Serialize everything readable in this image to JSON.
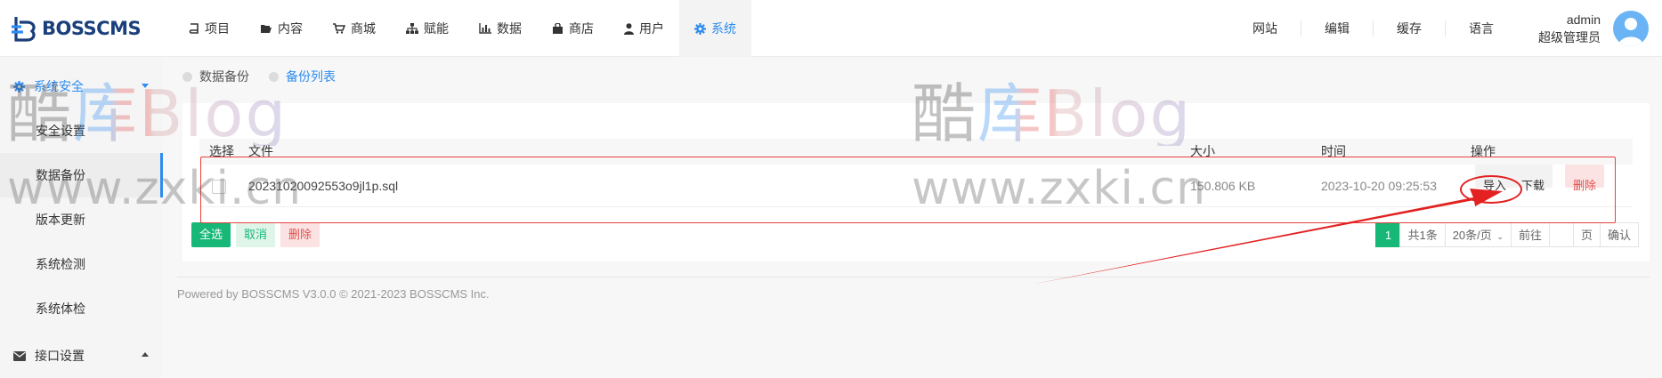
{
  "brand": {
    "name": "BOSSCMS",
    "color": "#1a3f7a",
    "accent": "#2d8cf0"
  },
  "nav": [
    {
      "label": "项目",
      "icon": "book-icon"
    },
    {
      "label": "内容",
      "icon": "folder-open-icon"
    },
    {
      "label": "商城",
      "icon": "shopping-cart-icon"
    },
    {
      "label": "赋能",
      "icon": "sitemap-icon"
    },
    {
      "label": "数据",
      "icon": "bar-chart-icon"
    },
    {
      "label": "商店",
      "icon": "store-bag-icon"
    },
    {
      "label": "用户",
      "icon": "user-icon"
    },
    {
      "label": "系统",
      "icon": "gear-icon",
      "active": true
    }
  ],
  "top_links": [
    "网站",
    "编辑",
    "缓存",
    "语言"
  ],
  "user": {
    "name": "admin",
    "role": "超级管理员"
  },
  "sidebar": {
    "group_security": {
      "label": "系统安全",
      "icon": "gear-icon",
      "expanded": true
    },
    "items": [
      {
        "label": "安全设置"
      },
      {
        "label": "数据备份",
        "active": true
      },
      {
        "label": "版本更新"
      },
      {
        "label": "系统检测"
      },
      {
        "label": "系统体检"
      }
    ],
    "group_api": {
      "label": "接口设置",
      "icon": "envelope-icon"
    }
  },
  "subtabs": [
    {
      "label": "数据备份",
      "active": false
    },
    {
      "label": "备份列表",
      "active": true
    }
  ],
  "table": {
    "headers": {
      "select": "选择",
      "file": "文件",
      "size": "大小",
      "time": "时间",
      "ops": "操作"
    },
    "rows": [
      {
        "file": "20231020092553o9jl1p.sql",
        "size": "150.806 KB",
        "time": "2023-10-20 09:25:53",
        "import": "导入",
        "download": "下载",
        "delete": "删除"
      }
    ]
  },
  "bulk": {
    "select_all": "全选",
    "cancel": "取消",
    "delete": "删除"
  },
  "pager": {
    "current": "1",
    "total": "共1条",
    "per_page": "20条/页",
    "goto": "前往",
    "page_unit": "页",
    "confirm": "确认"
  },
  "footer": "Powered by BOSSCMS V3.0.0 © 2021-2023 BOSSCMS Inc.",
  "watermark": {
    "text": "酷库Blog",
    "url": "www.zxki.cn"
  },
  "colors": {
    "green": "#16b777",
    "danger": "#e2504e",
    "annotation": "#e32121"
  }
}
